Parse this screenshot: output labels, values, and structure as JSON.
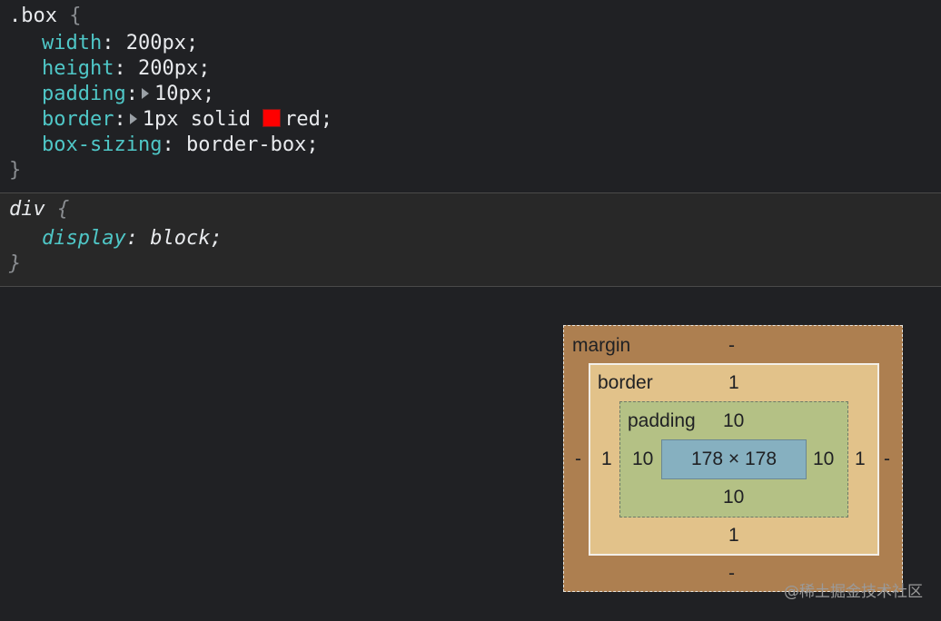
{
  "rules": {
    "box": {
      "selector": ".box",
      "open_brace": "{",
      "close_brace": "}",
      "declarations": [
        {
          "property": "width",
          "value": "200px;"
        },
        {
          "property": "height",
          "value": "200px;"
        },
        {
          "property": "padding",
          "value": "10px;"
        },
        {
          "property": "border",
          "value_before_swatch": "1px solid ",
          "value_after_swatch": "red;"
        },
        {
          "property": "box-sizing",
          "value": "border-box;"
        }
      ],
      "swatch_color": "#ff0000"
    },
    "ua": {
      "selector": "div",
      "open_brace": "{",
      "close_brace": "}",
      "declarations": [
        {
          "property": "display",
          "value": "block;"
        }
      ]
    }
  },
  "box_model": {
    "margin": {
      "label": "margin",
      "top": "-",
      "bottom": "-",
      "left": "-",
      "right": "-"
    },
    "border": {
      "label": "border",
      "top": "1",
      "bottom": "1",
      "left": "1",
      "right": "1"
    },
    "padding": {
      "label": "padding",
      "top": "10",
      "bottom": "10",
      "left": "10",
      "right": "10"
    },
    "content": {
      "size": "178 × 178"
    }
  },
  "watermark": "@稀土掘金技术社区",
  "colors": {
    "margin": "#ad7f50",
    "border": "#e2c28a",
    "padding": "#b4c185",
    "content": "#86b0c0"
  }
}
